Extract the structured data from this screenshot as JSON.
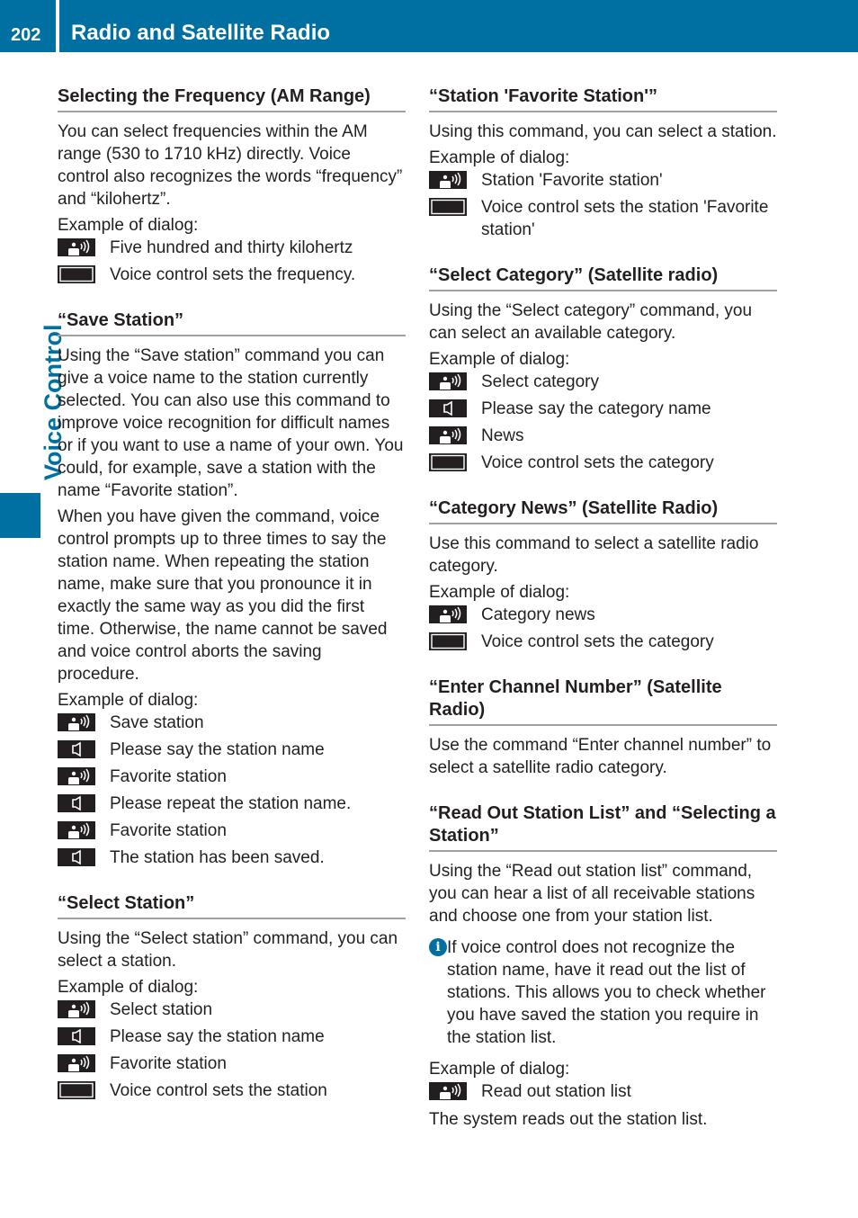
{
  "header": {
    "page_number": "202",
    "title": "Radio and Satellite Radio"
  },
  "side_tab": {
    "label": "Voice Control"
  },
  "colors": {
    "accent": "#0070a3",
    "text": "#231f20",
    "rule": "#a0a0a0"
  },
  "icons": {
    "voice": "voice-command-icon",
    "speaker": "speaker-prompt-icon",
    "display": "display-result-icon",
    "info": "info-icon"
  },
  "left": {
    "s1": {
      "heading": "Selecting the Frequency (AM Range)",
      "body": "You can select frequencies within the AM range (530 to 1710 kHz) directly. Voice control also recognizes the words “frequency” and “kilohertz”.",
      "example": "Example of dialog:",
      "dialog": [
        "Five hundred and thirty kilohertz",
        "Voice control sets the frequency."
      ]
    },
    "s2": {
      "heading": "“Save Station”",
      "body1": "Using the “Save station” command you can give a voice name to the station currently selected. You can also use this command to improve voice recognition for difficult names or if you want to use a name of your own. You could, for example, save a station with the name “Favorite station”.",
      "body2": "When you have given the command, voice control prompts up to three times to say the station name. When repeating the station name, make sure that you pronounce it in exactly the same way as you did the first time. Otherwise, the name cannot be saved and voice control aborts the saving procedure.",
      "example": "Example of dialog:",
      "dialog": [
        "Save station",
        "Please say the station name",
        "Favorite station",
        "Please repeat the station name.",
        "Favorite station",
        "The station has been saved."
      ]
    },
    "s3": {
      "heading": "“Select Station”",
      "body": "Using the “Select station” command, you can select a station.",
      "example": "Example of dialog:",
      "dialog": [
        "Select station",
        "Please say the station name",
        "Favorite station",
        "Voice control sets the station"
      ]
    }
  },
  "right": {
    "s1": {
      "heading": "“Station 'Favorite Station'”",
      "body": "Using this command, you can select a station.",
      "example": "Example of dialog:",
      "dialog": [
        "Station 'Favorite station'",
        "Voice control sets the station 'Favorite station'"
      ]
    },
    "s2": {
      "heading": "“Select Category” (Satellite radio)",
      "body": "Using the “Select category” command, you can select an available category.",
      "example": "Example of dialog:",
      "dialog": [
        "Select category",
        "Please say the category name",
        "News",
        "Voice control sets the category"
      ]
    },
    "s3": {
      "heading": "“Category News” (Satellite Radio)",
      "body": "Use this command to select a satellite radio category.",
      "example": "Example of dialog:",
      "dialog": [
        "Category news",
        "Voice control sets the category"
      ]
    },
    "s4": {
      "heading": "“Enter Channel Number” (Satellite Radio)",
      "body": "Use the command “Enter channel number” to select a satellite radio category."
    },
    "s5": {
      "heading": "“Read Out Station List” and “Selecting a Station”",
      "body": "Using the “Read out station list” command, you can hear a list of all receivable stations and choose one from your station list.",
      "note": "If voice control does not recognize the station name, have it read out the list of stations. This allows you to check whether you have saved the station you require in the station list.",
      "example": "Example of dialog:",
      "dialog": [
        "Read out station list"
      ],
      "closing": "The system reads out the station list."
    }
  }
}
